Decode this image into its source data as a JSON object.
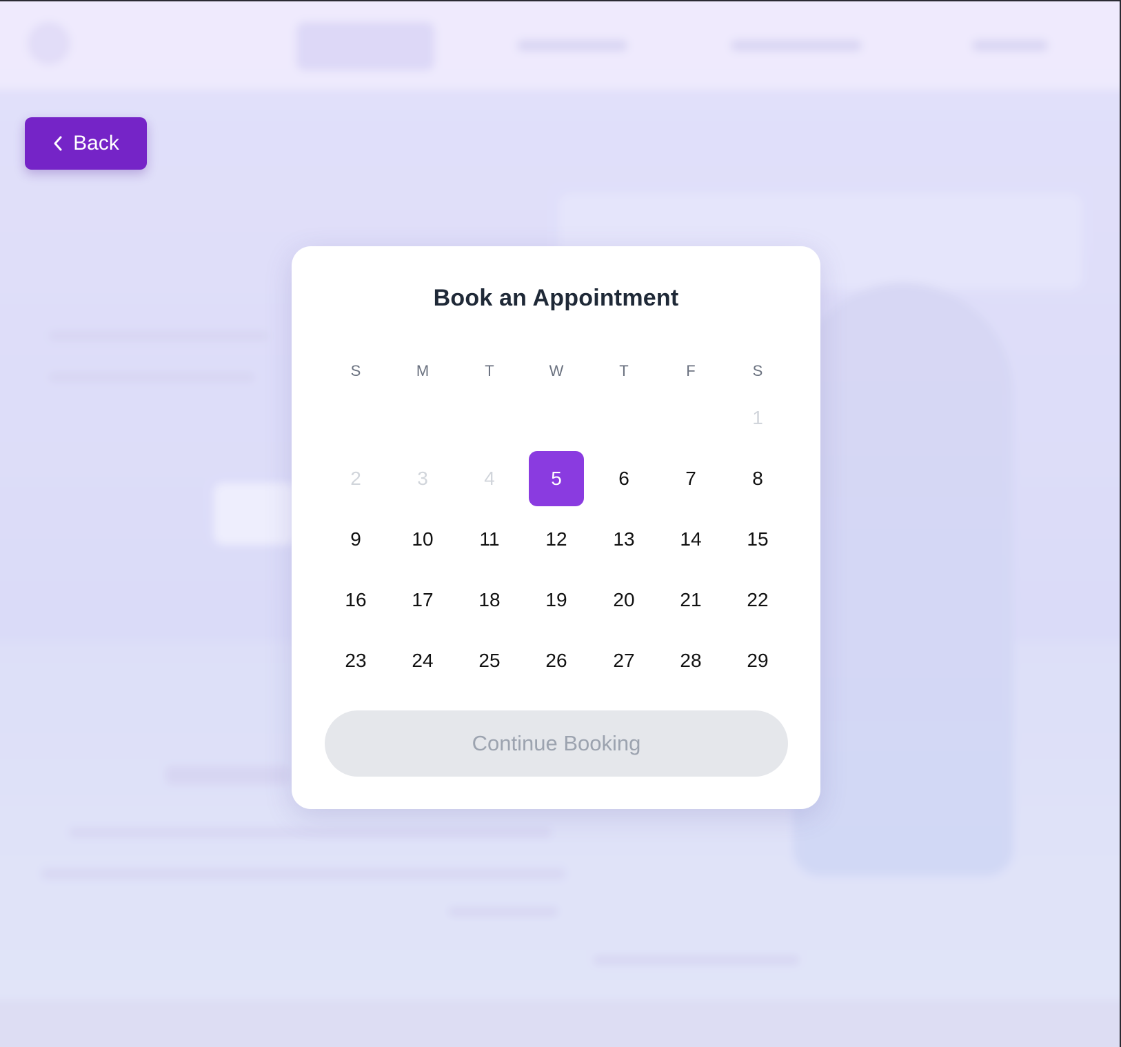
{
  "back_button": {
    "label": "Back"
  },
  "modal": {
    "title": "Book an Appointment",
    "weekdays": [
      "S",
      "M",
      "T",
      "W",
      "T",
      "F",
      "S"
    ],
    "weeks": [
      [
        null,
        null,
        null,
        null,
        null,
        null,
        "1"
      ],
      [
        "2",
        "3",
        "4",
        "5",
        "6",
        "7",
        "8"
      ],
      [
        "9",
        "10",
        "11",
        "12",
        "13",
        "14",
        "15"
      ],
      [
        "16",
        "17",
        "18",
        "19",
        "20",
        "21",
        "22"
      ],
      [
        "23",
        "24",
        "25",
        "26",
        "27",
        "28",
        "29"
      ]
    ],
    "disabled_days": [
      "1",
      "2",
      "3",
      "4"
    ],
    "selected_day": "5",
    "continue_label": "Continue Booking"
  },
  "colors": {
    "accent": "#8a3be0",
    "back_button": "#7524c7",
    "continue_bg": "#e5e7eb",
    "continue_text": "#9ca3af"
  }
}
